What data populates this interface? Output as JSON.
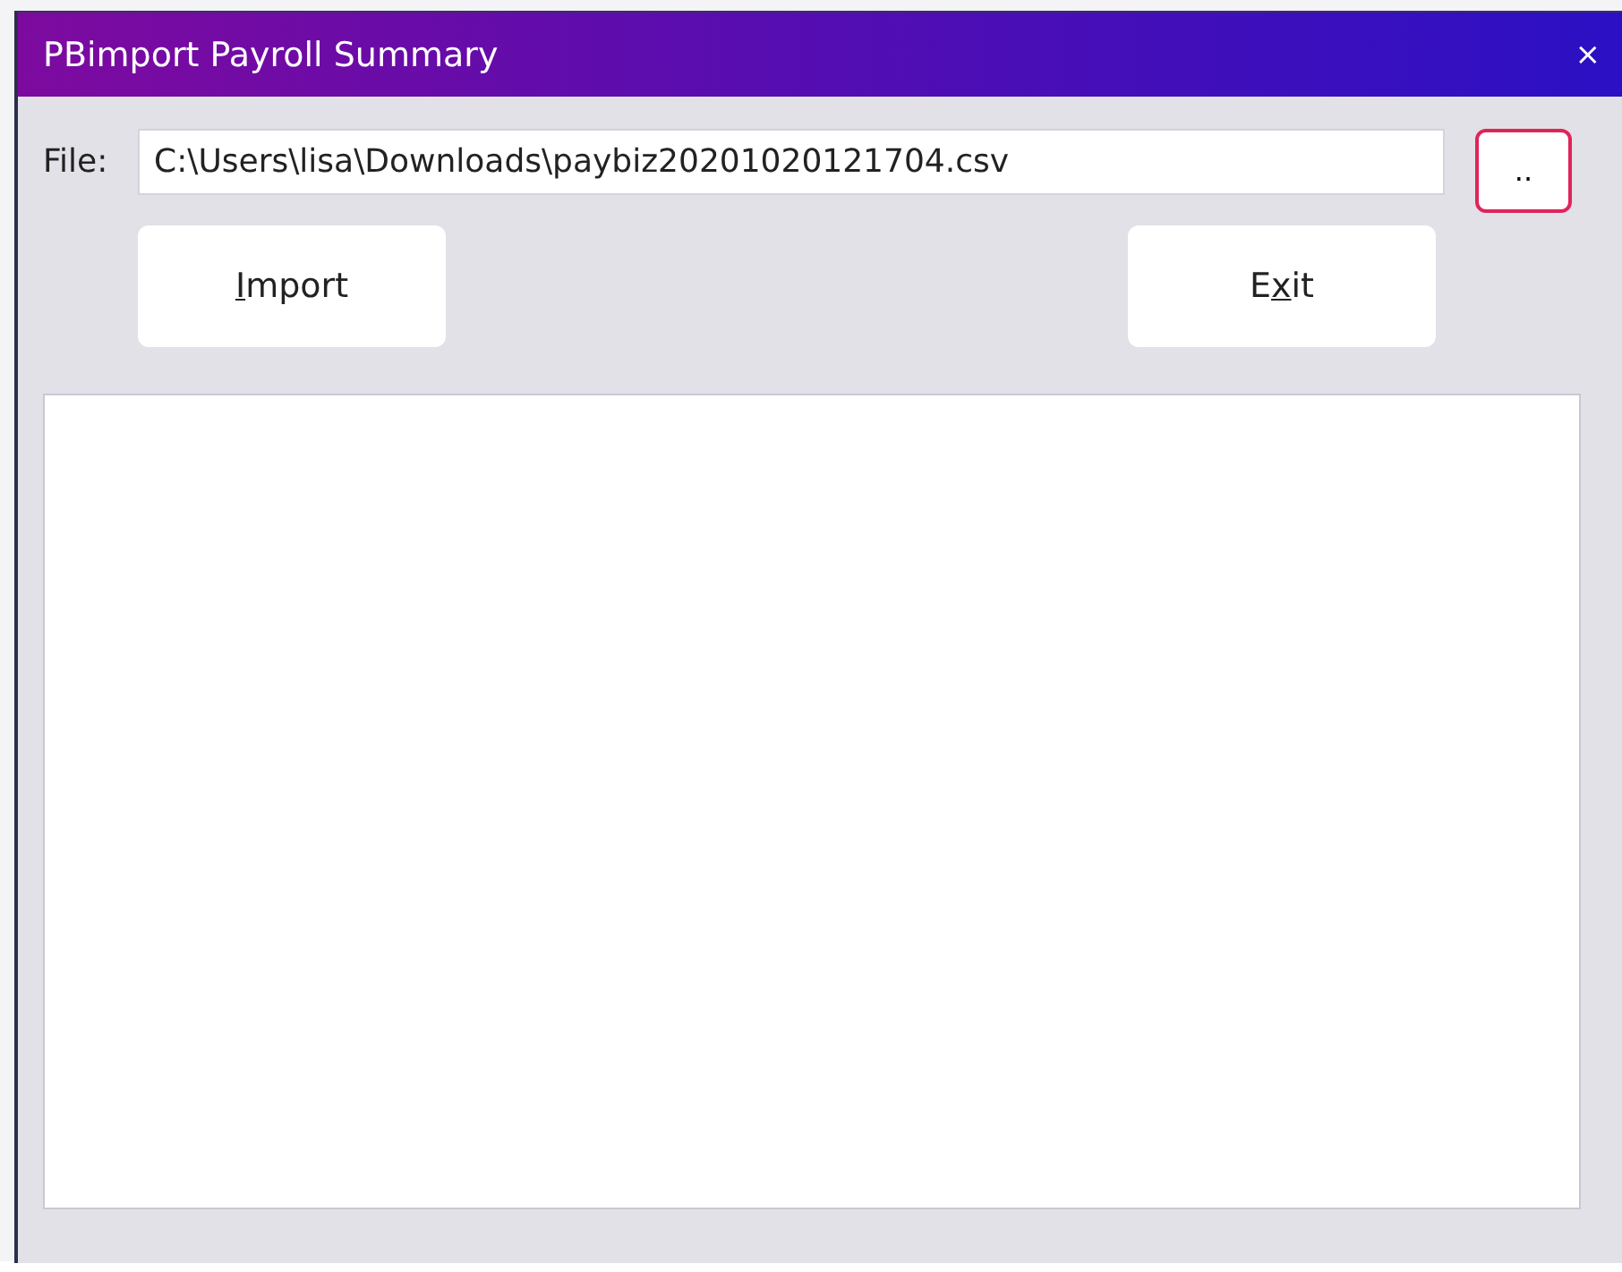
{
  "window": {
    "title": "PBimport Payroll Summary",
    "close": "×"
  },
  "file": {
    "label": "File:",
    "value": "C:\\Users\\lisa\\Downloads\\paybiz20201020121704.csv",
    "browse": "..",
    "browse_focused": true
  },
  "buttons": [
    {
      "parts": [
        {
          "text": "I",
          "underlined": true
        },
        {
          "text": "mport",
          "underlined": false
        }
      ]
    },
    {
      "parts": [
        {
          "text": "E",
          "underlined": false
        },
        {
          "text": "x",
          "underlined": true
        },
        {
          "text": "it",
          "underlined": false
        }
      ]
    }
  ]
}
